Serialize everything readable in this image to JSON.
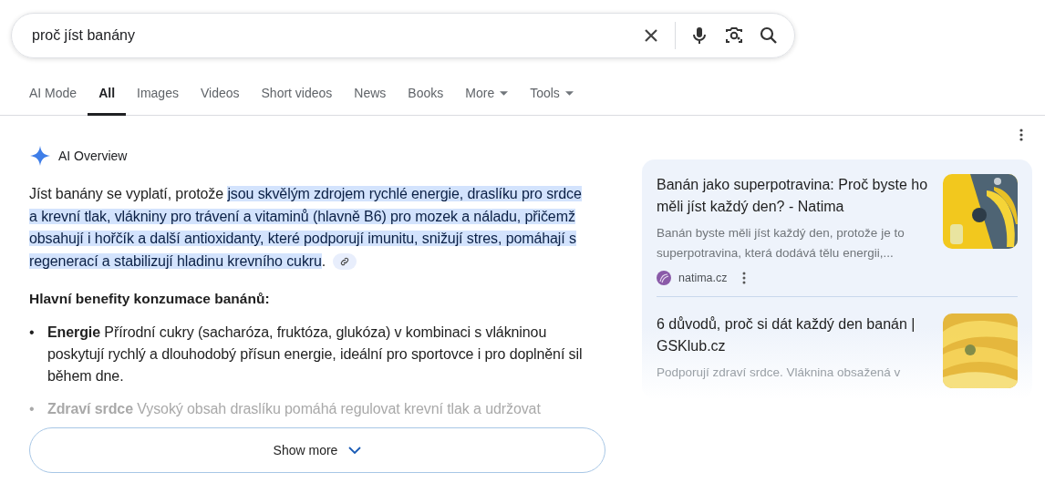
{
  "search": {
    "value": "proč jíst banány"
  },
  "tabs": [
    {
      "label": "AI Mode",
      "selected": false,
      "kind": "link"
    },
    {
      "label": "All",
      "selected": true,
      "kind": "link"
    },
    {
      "label": "Images",
      "selected": false,
      "kind": "link"
    },
    {
      "label": "Videos",
      "selected": false,
      "kind": "link"
    },
    {
      "label": "Short videos",
      "selected": false,
      "kind": "link"
    },
    {
      "label": "News",
      "selected": false,
      "kind": "link"
    },
    {
      "label": "Books",
      "selected": false,
      "kind": "link"
    },
    {
      "label": "More",
      "selected": false,
      "kind": "menu"
    },
    {
      "label": "Tools",
      "selected": false,
      "kind": "menu"
    }
  ],
  "overview": {
    "title": "AI Overview",
    "intro": "Jíst banány se vyplatí, protože ",
    "highlight": "jsou skvělým zdrojem rychlé energie, draslíku pro srdce a krevní tlak, vlákniny pro trávení a vitaminů (hlavně B6) pro mozek a náladu, přičemž obsahují i hořčík a další antioxidanty, které podporují imunitu, snižují stres, pomáhají s regenerací a stabilizují hladinu krevního cukru",
    "end": ".",
    "heading": "Hlavní benefity konzumace banánů:",
    "bullets": [
      {
        "marker": "•",
        "term": "Energie",
        "text": "Přírodní cukry (sacharóza, fruktóza, glukóza) v kombinaci s vlákninou poskytují rychlý a dlouhodobý přísun energie, ideální pro sportovce i pro doplnění sil během dne.",
        "faded": false
      },
      {
        "marker": "•",
        "term": "Zdraví srdce",
        "text": "Vysoký obsah draslíku pomáhá regulovat krevní tlak a udržovat",
        "faded": true
      }
    ],
    "show_more": "Show more"
  },
  "sources": [
    {
      "title": "Banán jako superpotravina: Proč byste ho měli jíst každý den? - Natima",
      "snippet": "Banán byste měli jíst každý den, protože je to superpotravina, která dodává tělu energii,...",
      "site": "natima.cz",
      "faded": false
    },
    {
      "title": "6 důvodů, proč si dát každý den banán | GSKlub.cz",
      "snippet": "Podporují zdraví srdce. Vláknina obsažená v",
      "faded": true
    }
  ]
}
